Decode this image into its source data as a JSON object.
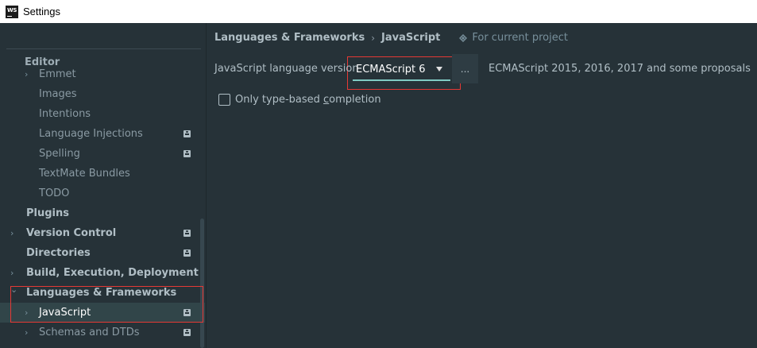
{
  "window": {
    "title": "Settings",
    "logo_text": "WS"
  },
  "sidebar": {
    "items": [
      {
        "label": "Editor",
        "level": "head",
        "arrow": "",
        "project_icon": false,
        "selected": false
      },
      {
        "label": "Emmet",
        "level": 1,
        "arrow": "›",
        "project_icon": false,
        "selected": false
      },
      {
        "label": "Images",
        "level": 1,
        "arrow": "",
        "project_icon": false,
        "selected": false
      },
      {
        "label": "Intentions",
        "level": 1,
        "arrow": "",
        "project_icon": false,
        "selected": false
      },
      {
        "label": "Language Injections",
        "level": 1,
        "arrow": "",
        "project_icon": true,
        "selected": false
      },
      {
        "label": "Spelling",
        "level": 1,
        "arrow": "",
        "project_icon": true,
        "selected": false
      },
      {
        "label": "TextMate Bundles",
        "level": 1,
        "arrow": "",
        "project_icon": false,
        "selected": false
      },
      {
        "label": "TODO",
        "level": 1,
        "arrow": "",
        "project_icon": false,
        "selected": false
      },
      {
        "label": "Plugins",
        "level": 0,
        "arrow": "",
        "project_icon": false,
        "selected": false
      },
      {
        "label": "Version Control",
        "level": 0,
        "arrow": "›",
        "project_icon": true,
        "selected": false
      },
      {
        "label": "Directories",
        "level": 0,
        "arrow": "",
        "project_icon": true,
        "selected": false
      },
      {
        "label": "Build, Execution, Deployment",
        "level": 0,
        "arrow": "›",
        "project_icon": false,
        "selected": false
      },
      {
        "label": "Languages & Frameworks",
        "level": 0,
        "arrow": "⌄",
        "project_icon": false,
        "selected": false
      },
      {
        "label": "JavaScript",
        "level": 1,
        "arrow": "›",
        "project_icon": true,
        "selected": true
      },
      {
        "label": "Schemas and DTDs",
        "level": 1,
        "arrow": "›",
        "project_icon": true,
        "selected": false
      }
    ]
  },
  "breadcrumb": {
    "parent": "Languages & Frameworks",
    "separator": "›",
    "current": "JavaScript",
    "scope": "For current project"
  },
  "javascript": {
    "language_version_label": "JavaScript language version",
    "language_version_value": "ECMAScript 6",
    "ellipsis_label": "...",
    "language_version_description": "ECMAScript 2015, 2016, 2017 and some proposals",
    "only_type_based_prefix": "Only type-based ",
    "only_type_based_mnemonic": "c",
    "only_type_based_suffix": "ompletion",
    "only_type_based_checked": false
  },
  "colors": {
    "background": "#263238",
    "accent_underline": "#80cbc4",
    "highlight_box": "#e53935",
    "selected_row": "#314549"
  }
}
